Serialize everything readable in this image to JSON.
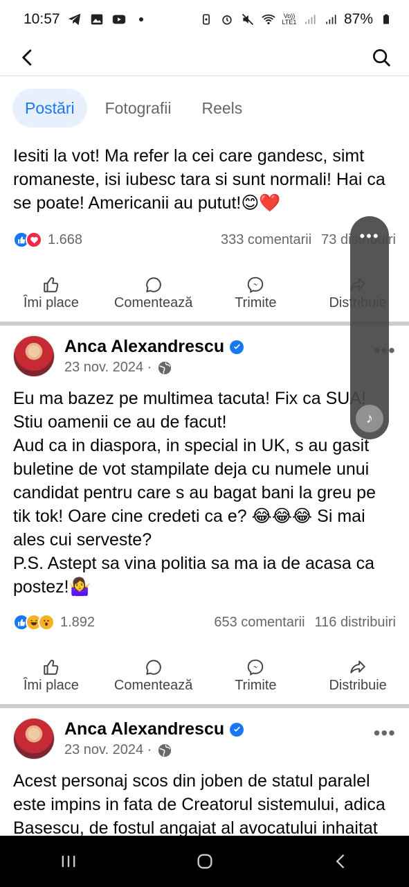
{
  "status_bar": {
    "time": "10:57",
    "battery": "87%",
    "icons_left": [
      "telegram-icon",
      "gallery-icon",
      "youtube-icon",
      "dot-icon"
    ],
    "icons_right": [
      "battery-saver-icon",
      "alarm-icon",
      "mute-icon",
      "wifi-icon",
      "volte-icon",
      "signal-icon",
      "signal-icon",
      "battery-icon"
    ],
    "volte_label": "Vo))\nLTE1"
  },
  "header": {
    "back_icon": "back-arrow-icon",
    "search_icon": "search-icon"
  },
  "tabs": [
    {
      "label": "Postări",
      "active": true
    },
    {
      "label": "Fotografii",
      "active": false
    },
    {
      "label": "Reels",
      "active": false
    }
  ],
  "posts": [
    {
      "text": "Iesiti la vot! Ma refer la cei care gandesc, simt romaneste, isi iubesc tara si sunt normali! Hai ca se poate! Americanii au putut!😊❤️",
      "reactions": [
        "like",
        "love"
      ],
      "reaction_count": "1.668",
      "comments": "333 comentarii",
      "shares": "73 distribuiri"
    },
    {
      "author": "Anca Alexandrescu",
      "date": "23 nov. 2024 ·",
      "text": "Eu ma bazez pe multimea tacuta! Fix ca SUA! Stiu oamenii ce au de facut!\nAud ca in diaspora, in special in UK, s au gasit buletine de vot stampilate deja cu numele unui candidat pentru care s au bagat bani la greu pe tik tok! Oare cine credeti ca e? 😂😂😂 Si mai ales cui serveste?\nP.S. Astept sa vina politia sa ma ia de acasa ca postez!🤷‍♀️",
      "reactions": [
        "like",
        "haha",
        "wow"
      ],
      "reaction_count": "1.892",
      "comments": "653 comentarii",
      "shares": "116 distribuiri"
    },
    {
      "author": "Anca Alexandrescu",
      "date": "23 nov. 2024 ·",
      "text": "Acest personaj scos din joben de statul paralel este impins in fata de Creatorul sistemului, adica Basescu, de fostul angajat al avocatului inhaitat cu Coldea si Dumbrava, adica Orban si de slugile aceluiasi sistem din"
    }
  ],
  "actions": {
    "like": "Îmi place",
    "comment": "Comentează",
    "send": "Trimite",
    "share": "Distribuie"
  },
  "colors": {
    "accent": "#1877f2",
    "tab_active_bg": "#e7f0fc",
    "muted_text": "#65676b",
    "separator": "#cbcdd1",
    "nav_bg": "#000000"
  }
}
